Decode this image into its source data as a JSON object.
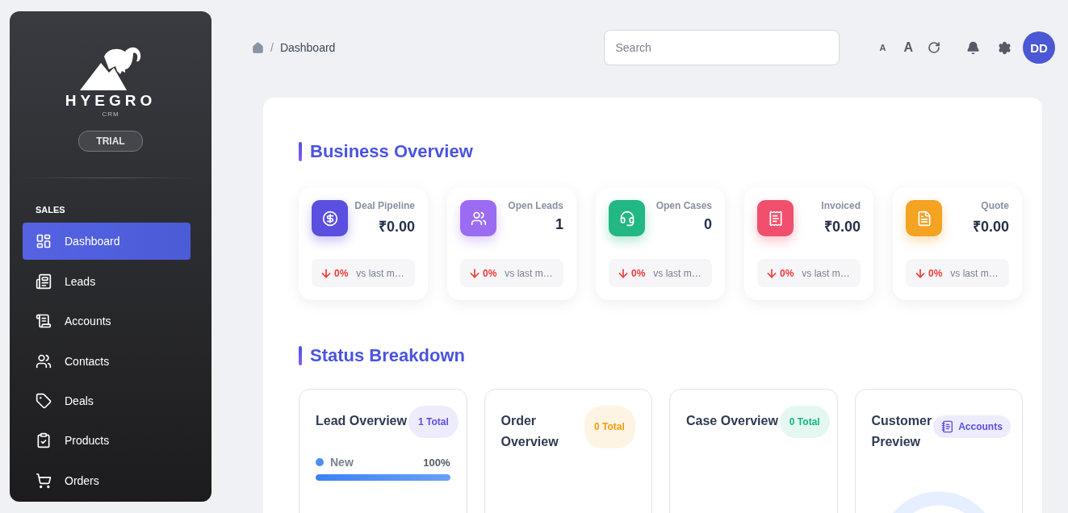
{
  "sidebar": {
    "brand": "HYEGRO",
    "brand_sub": "CRM",
    "plan_badge": "TRIAL",
    "section": "SALES",
    "items": [
      {
        "label": "Dashboard",
        "selected": true
      },
      {
        "label": "Leads",
        "selected": false
      },
      {
        "label": "Accounts",
        "selected": false
      },
      {
        "label": "Contacts",
        "selected": false
      },
      {
        "label": "Deals",
        "selected": false
      },
      {
        "label": "Products",
        "selected": false
      },
      {
        "label": "Orders",
        "selected": false
      }
    ]
  },
  "header": {
    "breadcrumb": [
      "Dashboard"
    ],
    "separator": "/",
    "search": {
      "placeholder": "Search"
    },
    "font_small": "A",
    "font_large": "A",
    "avatar": "DD"
  },
  "business_overview": {
    "title": "Business Overview",
    "cards": [
      {
        "label": "Deal Pipeline",
        "value": "₹0.00",
        "color": "#5b4fe0",
        "rising": false,
        "change": "0%",
        "compare": "vs last m…"
      },
      {
        "label": "Open Leads",
        "value": "1",
        "color": "#9b6cf2",
        "rising": false,
        "change": "0%",
        "compare": "vs last m…"
      },
      {
        "label": "Open Cases",
        "value": "0",
        "color": "#22b783",
        "rising": false,
        "change": "0%",
        "compare": "vs last m…"
      },
      {
        "label": "Invoiced",
        "value": "₹0.00",
        "color": "#f0506e",
        "rising": false,
        "change": "0%",
        "compare": "vs last m…"
      },
      {
        "label": "Quote",
        "value": "₹0.00",
        "color": "#f4a322",
        "rising": false,
        "change": "0%",
        "compare": "vs last m…"
      }
    ]
  },
  "status_breakdown": {
    "title": "Status Breakdown",
    "cards": [
      {
        "kind": "progress",
        "title": "Lead Overview",
        "badge": "1 Total",
        "color": "#5b4fe0",
        "rows": [
          {
            "label": "New",
            "reading": "100%",
            "level": 1
          }
        ]
      },
      {
        "kind": "plain",
        "title": "Order Overview",
        "badge": "0 Total",
        "color": "#f59e0b"
      },
      {
        "kind": "plain",
        "title": "Case Overview",
        "badge": "0 Total",
        "color": "#10b981"
      },
      {
        "kind": "donut",
        "title": "Customer Preview",
        "badge": "Accounts",
        "color": "#5b4fe0"
      }
    ]
  }
}
